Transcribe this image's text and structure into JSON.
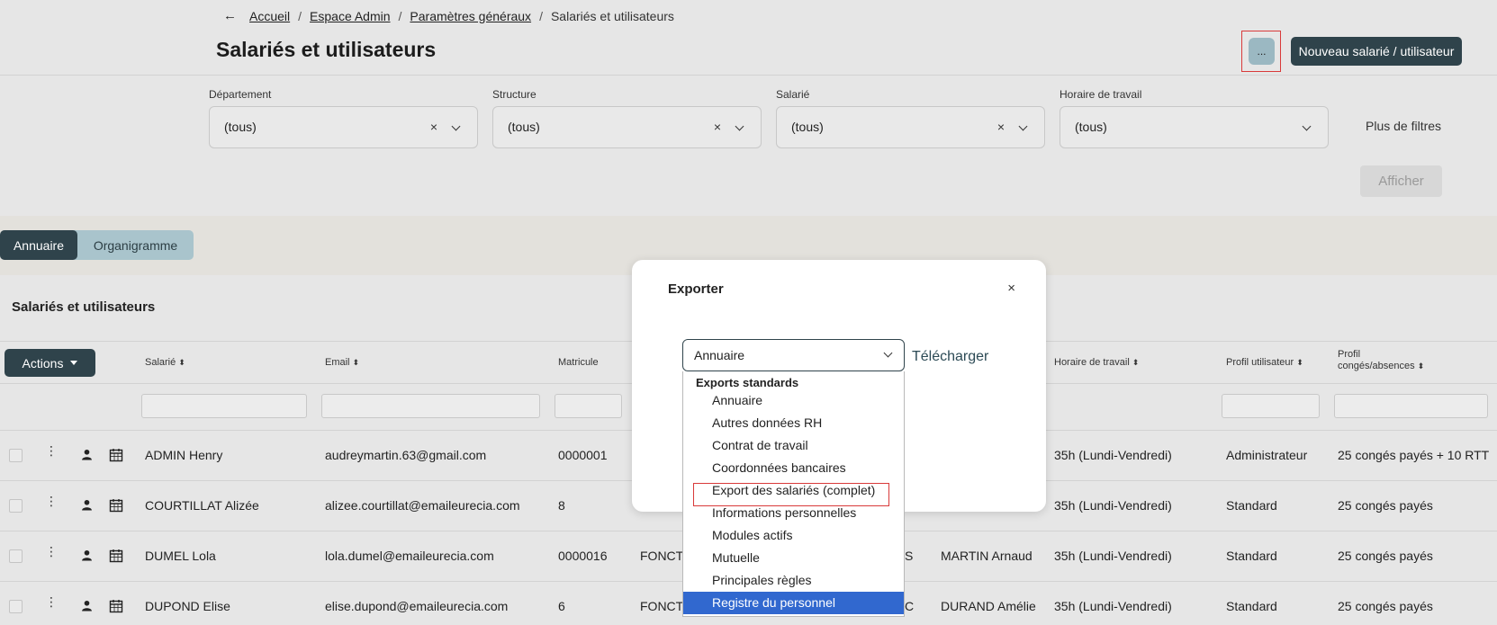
{
  "header": {
    "breadcrumb": [
      "Accueil",
      "Espace Admin",
      "Paramètres généraux"
    ],
    "breadcrumb_current": "Salariés et utilisateurs",
    "title": "Salariés et utilisateurs",
    "more_label": "...",
    "new_label": "Nouveau salarié / utilisateur"
  },
  "filters": {
    "items": [
      {
        "label": "Département",
        "value": "(tous)"
      },
      {
        "label": "Structure",
        "value": "(tous)"
      },
      {
        "label": "Salarié",
        "value": "(tous)"
      },
      {
        "label": "Horaire de travail",
        "value": "(tous)"
      }
    ],
    "clear_glyph": "×",
    "more_label": "Plus de filtres",
    "show_label": "Afficher"
  },
  "view": {
    "tabs": [
      "Annuaire",
      "Organigramme"
    ]
  },
  "table": {
    "title": "Salariés et utilisateurs",
    "actions_label": "Actions",
    "columns": {
      "salarie": "Salarié",
      "email": "Email",
      "matricule": "Matricule",
      "horaire": "Horaire de travail",
      "profil": "Profil utilisateur",
      "conges_1": "Profil",
      "conges_2": "congés/absences"
    },
    "rows": [
      {
        "name": "ADMIN Henry",
        "email": "audreymartin.63@gmail.com",
        "matricule": "0000001",
        "col4": "",
        "col5": "",
        "col6": "",
        "horaire": "35h (Lundi-Vendredi)",
        "profil": "Administrateur",
        "conges": "25 congés payés + 10 RTT"
      },
      {
        "name": "COURTILLAT Alizée",
        "email": "alizee.courtillat@emaileurecia.com",
        "matricule": "8",
        "col4": "",
        "col5": "",
        "col6": "",
        "horaire": "35h (Lundi-Vendredi)",
        "profil": "Standard",
        "conges": "25 congés payés"
      },
      {
        "name": "DUMEL Lola",
        "email": "lola.dumel@emaileurecia.com",
        "matricule": "0000016",
        "col4": "FONCTI",
        "col5": "S",
        "col6": "MARTIN Arnaud",
        "horaire": "35h (Lundi-Vendredi)",
        "profil": "Standard",
        "conges": "25 congés payés"
      },
      {
        "name": "DUPOND Elise",
        "email": "elise.dupond@emaileurecia.com",
        "matricule": "6",
        "col4": "FONCTI",
        "col5": "C",
        "col6": "DURAND Amélie",
        "horaire": "35h (Lundi-Vendredi)",
        "profil": "Standard",
        "conges": "25 congés payés"
      }
    ]
  },
  "modal": {
    "title": "Exporter",
    "close_glyph": "×",
    "selected": "Annuaire",
    "download_label": "Télécharger",
    "group_label": "Exports standards",
    "options": [
      "Annuaire",
      "Autres données RH",
      "Contrat de travail",
      "Coordonnées bancaires",
      "Export des salariés (complet)",
      "Informations personnelles",
      "Modules actifs",
      "Mutuelle",
      "Principales règles",
      "Registre du personnel"
    ]
  },
  "icons": {
    "back": "arrow-left-icon",
    "row_menu": "kebab-icon",
    "person": "person-icon",
    "calendar": "calendar-icon"
  },
  "colors": {
    "primary": "#2f434b",
    "accent_light": "#a9c4cc",
    "highlight": "#d93a3a",
    "selected_option": "#3168cf"
  }
}
